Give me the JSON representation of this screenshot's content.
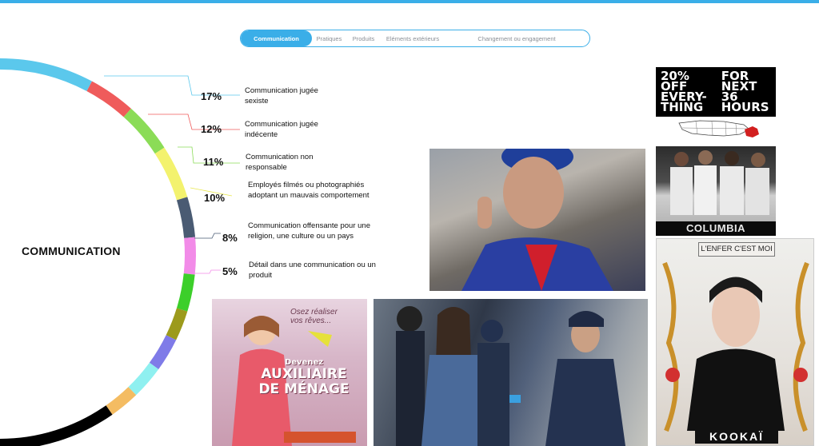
{
  "tabs": [
    {
      "label": "Communication",
      "active": true
    },
    {
      "label": "Pratiques",
      "active": false
    },
    {
      "label": "Produits",
      "active": false
    },
    {
      "label": "Eléments extérieurs",
      "active": false
    },
    {
      "label": "Changement ou engagement",
      "active": false
    }
  ],
  "wheel": {
    "title": "COMMUNICATION",
    "segment_colors": [
      "#5bc8ec",
      "#ef5b5b",
      "#8bdc57",
      "#f3f26e",
      "#4a5b73",
      "#f28be8",
      "#3ccf2a",
      "#9c9a1c",
      "#7f7be8",
      "#8ff0f0",
      "#f4bc62",
      "#000000"
    ]
  },
  "items": [
    {
      "pct": "17%",
      "label": "Communication jugée\nsexiste",
      "color": "#5bc8ec"
    },
    {
      "pct": "12%",
      "label": "Communication jugée\nindécente",
      "color": "#ef5b5b"
    },
    {
      "pct": "11%",
      "label": "Communication non\nresponsable",
      "color": "#8bdc57"
    },
    {
      "pct": "10%",
      "label": "Employés filmés ou photographiés\nadoptant un mauvais comportement",
      "color": "#e8e74d"
    },
    {
      "pct": "8%",
      "label": "Communication offensante pour une\nreligion, une culture ou un pays",
      "color": "#4a5b73"
    },
    {
      "pct": "5%",
      "label": "Détail dans une communication ou un\nproduit",
      "color": "#f28be8"
    }
  ],
  "images": {
    "sale_ad": {
      "left": "20%\nOFF\nEVERY-\nTHING",
      "right": "FOR\nNEXT\n36\nHOURS"
    },
    "soccer_ad": {
      "brand": "COLUMBIA"
    },
    "kookai_ad": {
      "headline": "L'ENFER C'EST MOI",
      "brand": "KOOKAÏ"
    },
    "girl_ad": {
      "top": "Osez réaliser\nvos rêves...",
      "line1": "Devenez",
      "line2": "AUXILIAIRE",
      "line3": "DE MÉNAGE"
    }
  }
}
